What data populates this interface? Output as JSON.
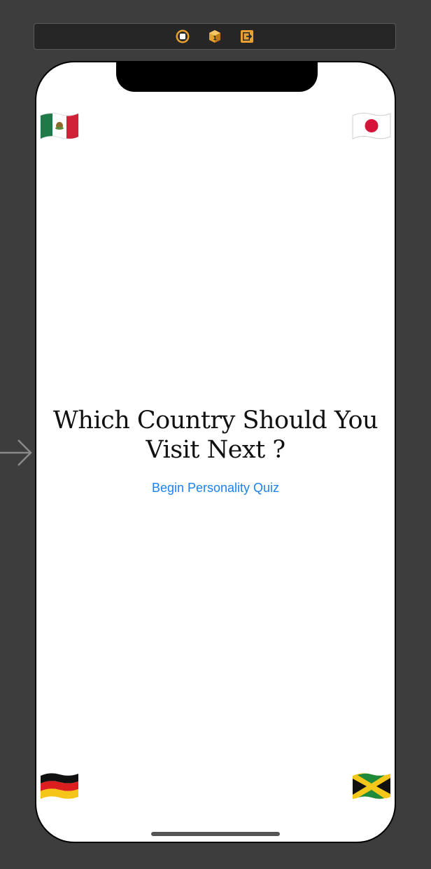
{
  "scene_dock": {
    "icons": [
      "view-controller-icon",
      "first-responder-icon",
      "exit-icon"
    ]
  },
  "screen": {
    "title": "Which Country Should You Visit Next ?",
    "begin_button_label": "Begin Personality Quiz",
    "flags": {
      "top_left": "mexico-flag-icon",
      "top_right": "japan-flag-icon",
      "bottom_left": "germany-flag-icon",
      "bottom_right": "jamaica-flag-icon"
    }
  },
  "colors": {
    "canvas_background": "#3d3d3d",
    "button_tint": "#1a82f0",
    "dock_accent": "#e8a030"
  }
}
